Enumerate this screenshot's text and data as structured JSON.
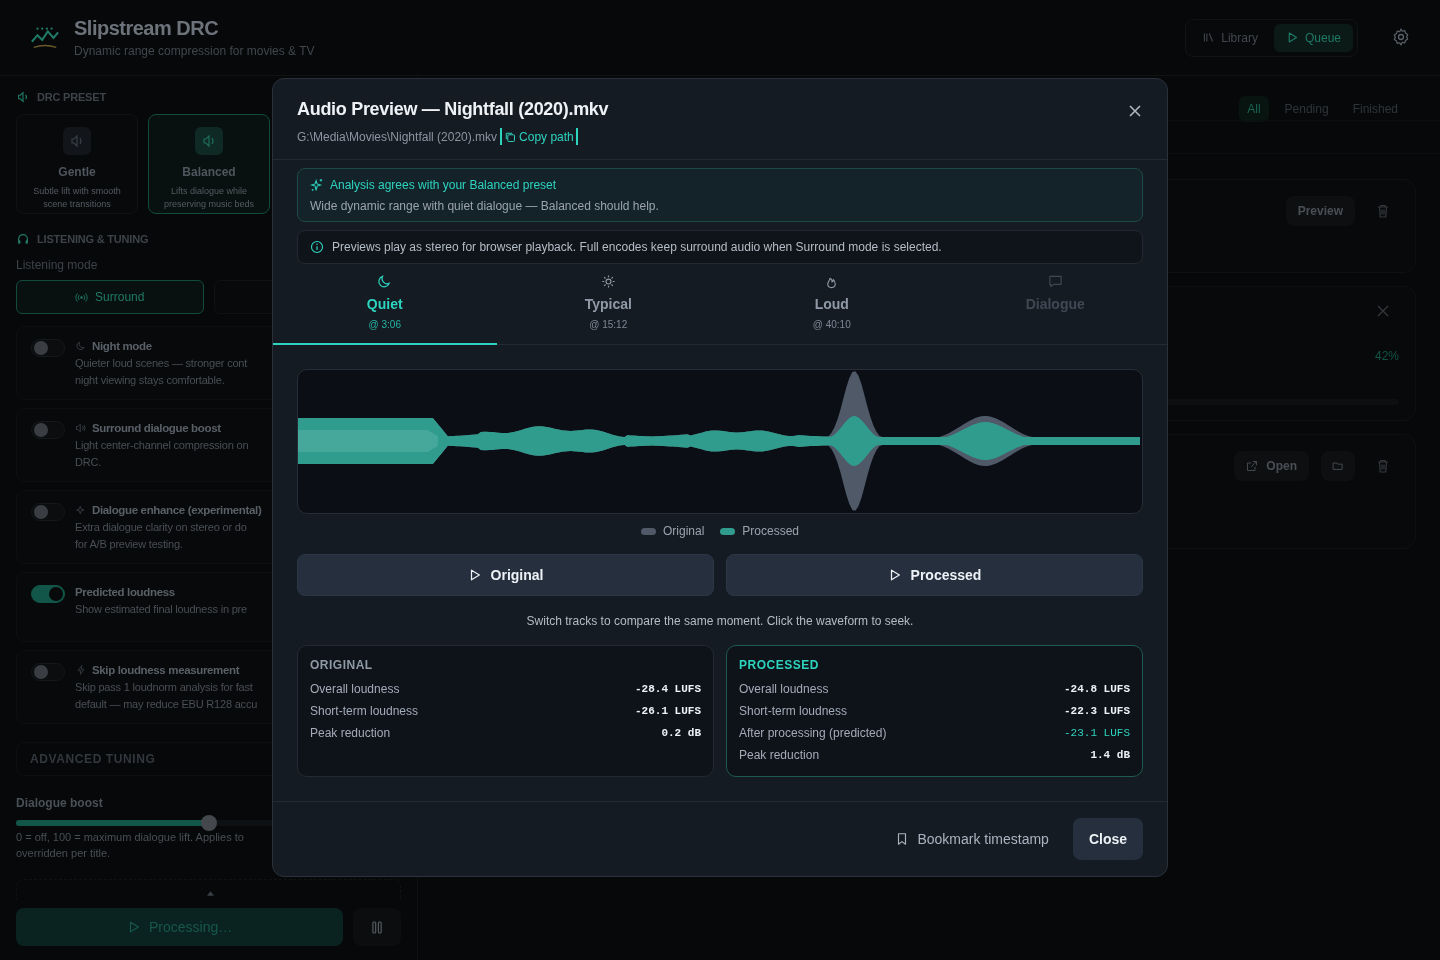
{
  "app": {
    "title": "Slipstream DRC",
    "subtitle": "Dynamic range compression for movies & TV",
    "nav": [
      {
        "label": "Library",
        "selected": false
      },
      {
        "label": "Queue",
        "selected": true
      }
    ]
  },
  "sidebar": {
    "preset_heading": "DRC PRESET",
    "presets": [
      {
        "name": "Gentle",
        "description": "Subtle lift with smooth scene transitions",
        "selected": false
      },
      {
        "name": "Balanced",
        "description": "Lifts dialogue while preserving music beds",
        "selected": true
      }
    ],
    "tuning_heading": "LISTENING & TUNING",
    "mode_label": "Listening mode",
    "modes": [
      {
        "label": "Surround",
        "selected": true
      },
      {
        "selected": false
      }
    ],
    "toggles": [
      {
        "title": "Night mode",
        "on": false,
        "lines": [
          "Quieter loud scenes — stronger cont",
          "night viewing stays comfortable."
        ]
      },
      {
        "title": "Surround dialogue boost",
        "on": false,
        "lines": [
          "Light center-channel compression on",
          "DRC."
        ]
      },
      {
        "title": "Dialogue enhance (experimental)",
        "on": false,
        "lines": [
          "Extra dialogue clarity on stereo or do",
          "for A/B preview testing."
        ]
      },
      {
        "title": "Predicted loudness",
        "on": true,
        "lines": [
          "Show estimated final loudness in pre"
        ]
      },
      {
        "title": "Skip loudness measurement",
        "on": false,
        "lines": [
          "Skip pass 1 loudnorm analysis for fast",
          "default — may reduce EBU R128 accu"
        ]
      }
    ],
    "advanced_heading": "ADVANCED TUNING",
    "slider": {
      "label": "Dialogue boost",
      "level": 0.5,
      "lines": [
        "0 = off, 100 = maximum dialogue lift. Applies to",
        "overridden per title."
      ]
    },
    "process_button": "Processing…"
  },
  "main": {
    "filters": [
      {
        "label": "All",
        "selected": true
      },
      {
        "label": "Pending",
        "selected": false
      },
      {
        "label": "Finished",
        "selected": false
      }
    ],
    "jobs": [
      {
        "kind": "ready",
        "button": "Preview"
      },
      {
        "kind": "running",
        "percent": "42%"
      },
      {
        "kind": "done",
        "button": "Open"
      }
    ]
  },
  "modal": {
    "title": "Audio Preview — Nightfall (2020).mkv",
    "path": "G:\\Media\\Movies\\Nightfall (2020).mkv",
    "copy_label": "Copy path",
    "analysis": {
      "title": "Analysis agrees with your Balanced preset",
      "text": "Wide dynamic range with quiet dialogue — Balanced should help."
    },
    "notice": "Previews play as stereo for browser playback. Full encodes keep surround audio when Surround mode is selected.",
    "scenes": [
      {
        "label": "Quiet",
        "time": "@ 3:06",
        "selected": true,
        "disabled": false
      },
      {
        "label": "Typical",
        "time": "@ 15:12",
        "selected": false,
        "disabled": false
      },
      {
        "label": "Loud",
        "time": "@ 40:10",
        "selected": false,
        "disabled": false
      },
      {
        "label": "Dialogue",
        "selected": false,
        "disabled": true
      }
    ],
    "legend": [
      {
        "label": "Original",
        "color": "#4f5968"
      },
      {
        "label": "Processed",
        "color": "#2f9c8d"
      }
    ],
    "play_buttons": [
      "Original",
      "Processed"
    ],
    "hint": "Switch tracks to compare the same moment. Click the waveform to seek.",
    "stats": [
      {
        "heading": "ORIGINAL",
        "highlight": false,
        "rows": [
          {
            "label": "Overall loudness",
            "value": "-28.4 LUFS",
            "accent": false
          },
          {
            "label": "Short-term loudness",
            "value": "-26.1 LUFS",
            "accent": false
          },
          {
            "label": "Peak reduction",
            "value": "0.2 dB",
            "accent": false
          }
        ]
      },
      {
        "heading": "PROCESSED",
        "highlight": true,
        "rows": [
          {
            "label": "Overall loudness",
            "value": "-24.8 LUFS",
            "accent": false
          },
          {
            "label": "Short-term loudness",
            "value": "-22.3 LUFS",
            "accent": false
          },
          {
            "label": "After processing (predicted)",
            "value": "-23.1 LUFS",
            "accent": true
          },
          {
            "label": "Peak reduction",
            "value": "1.4 dB",
            "accent": false
          }
        ]
      }
    ],
    "bookmark": "Bookmark timestamp",
    "close": "Close"
  }
}
